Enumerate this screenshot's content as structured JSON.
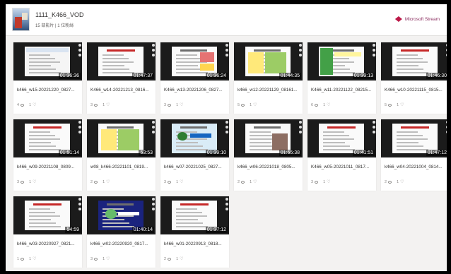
{
  "header": {
    "title": "1111_K466_VOD",
    "meta": "15 部影片 | 1 位粉絲",
    "brand": "Microsoft Stream"
  },
  "videos": [
    {
      "title": "k466_w15-20221220_0827...",
      "duration": "01:36:36",
      "views": "4",
      "likes": "1",
      "style": "sheet"
    },
    {
      "title": "K466_w14-20221213_0816...",
      "duration": "01:47:37",
      "views": "3",
      "likes": "1",
      "style": "doc"
    },
    {
      "title": "K466_w13-20221206_0827...",
      "duration": "01:36:24",
      "views": "3",
      "likes": "1",
      "style": "colorful"
    },
    {
      "title": "k466_w12-20221129_08161...",
      "duration": "01:44:35",
      "views": "5",
      "likes": "1",
      "style": "yellow"
    },
    {
      "title": "K466_w11-20221122_08215...",
      "duration": "01:39:13",
      "views": "6",
      "likes": "1",
      "style": "green"
    },
    {
      "title": "K466_w10-20221115_0815...",
      "duration": "01:46:30",
      "views": "5",
      "likes": "1",
      "style": "doc"
    },
    {
      "title": "k466_w09-20221108_0809...",
      "duration": "01:51:14",
      "views": "3",
      "likes": "1",
      "style": "doc"
    },
    {
      "title": "w08_k466-20221101_0819...",
      "duration": "53:53",
      "views": "2",
      "likes": "1",
      "style": "yellow"
    },
    {
      "title": "k466_w07-20221025_0827...",
      "duration": "01:39:10",
      "views": "3",
      "likes": "1",
      "style": "blue"
    },
    {
      "title": "k466_w06-20221018_0805...",
      "duration": "01:55:38",
      "views": "2",
      "likes": "1",
      "style": "photo"
    },
    {
      "title": "K466_w05-20221011_0817...",
      "duration": "01:41:51",
      "views": "3",
      "likes": "1",
      "style": "doc"
    },
    {
      "title": "k466_w04-20221004_0814...",
      "duration": "01:47:12",
      "views": "2",
      "likes": "1",
      "style": "doc"
    },
    {
      "title": "k466_w03-20220927_0821...",
      "duration": "54:59",
      "views": "1",
      "likes": "1",
      "style": "doc"
    },
    {
      "title": "k466_w02-20220920_0817...",
      "duration": "01:40:14",
      "views": "3",
      "likes": "1",
      "style": "purple"
    },
    {
      "title": "k466_w01-20220913_0818...",
      "duration": "01:37:12",
      "views": "2",
      "likes": "1",
      "style": "doc"
    }
  ]
}
